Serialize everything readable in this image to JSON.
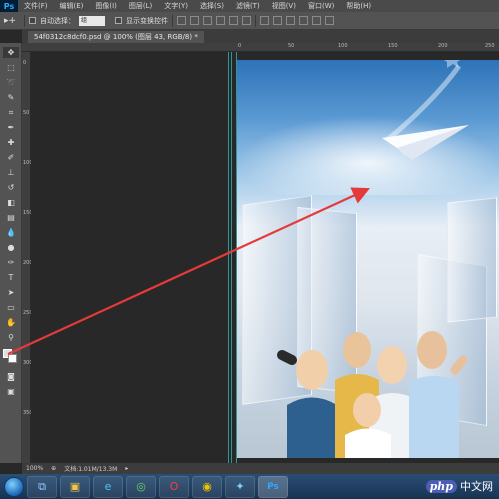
{
  "app": {
    "logo": "Ps"
  },
  "menu": [
    "文件(F)",
    "编辑(E)",
    "图像(I)",
    "图层(L)",
    "文字(Y)",
    "选择(S)",
    "滤镜(T)",
    "视图(V)",
    "窗口(W)",
    "帮助(H)"
  ],
  "options": {
    "tool_glyph": "▸+",
    "auto_select_label": "自动选择：",
    "auto_select_value": "组",
    "show_transform_label": "显示变换控件"
  },
  "document": {
    "tab_label": "54f0312c8dcf0.psd @ 100% (图层 43, RGB/8) *",
    "zoom": "100%",
    "doc_info": "文档:1.01M/13.3M"
  },
  "rulers": {
    "top": [
      "0",
      "50",
      "100",
      "150",
      "200",
      "250",
      "300"
    ],
    "left": [
      "0",
      "50",
      "100",
      "150",
      "200",
      "250",
      "300",
      "350"
    ]
  },
  "taskbar": {
    "icons": [
      "start-orb",
      "window-switcher",
      "file-explorer",
      "ie-browser",
      "360-browser",
      "opera",
      "chrome",
      "network",
      "photoshop"
    ]
  },
  "watermark": {
    "badge": "php",
    "text": "中文网"
  },
  "colors": {
    "annotation_arrow": "#e53a3a",
    "guide": "#35c4c4",
    "ui_dark": "#282828"
  }
}
